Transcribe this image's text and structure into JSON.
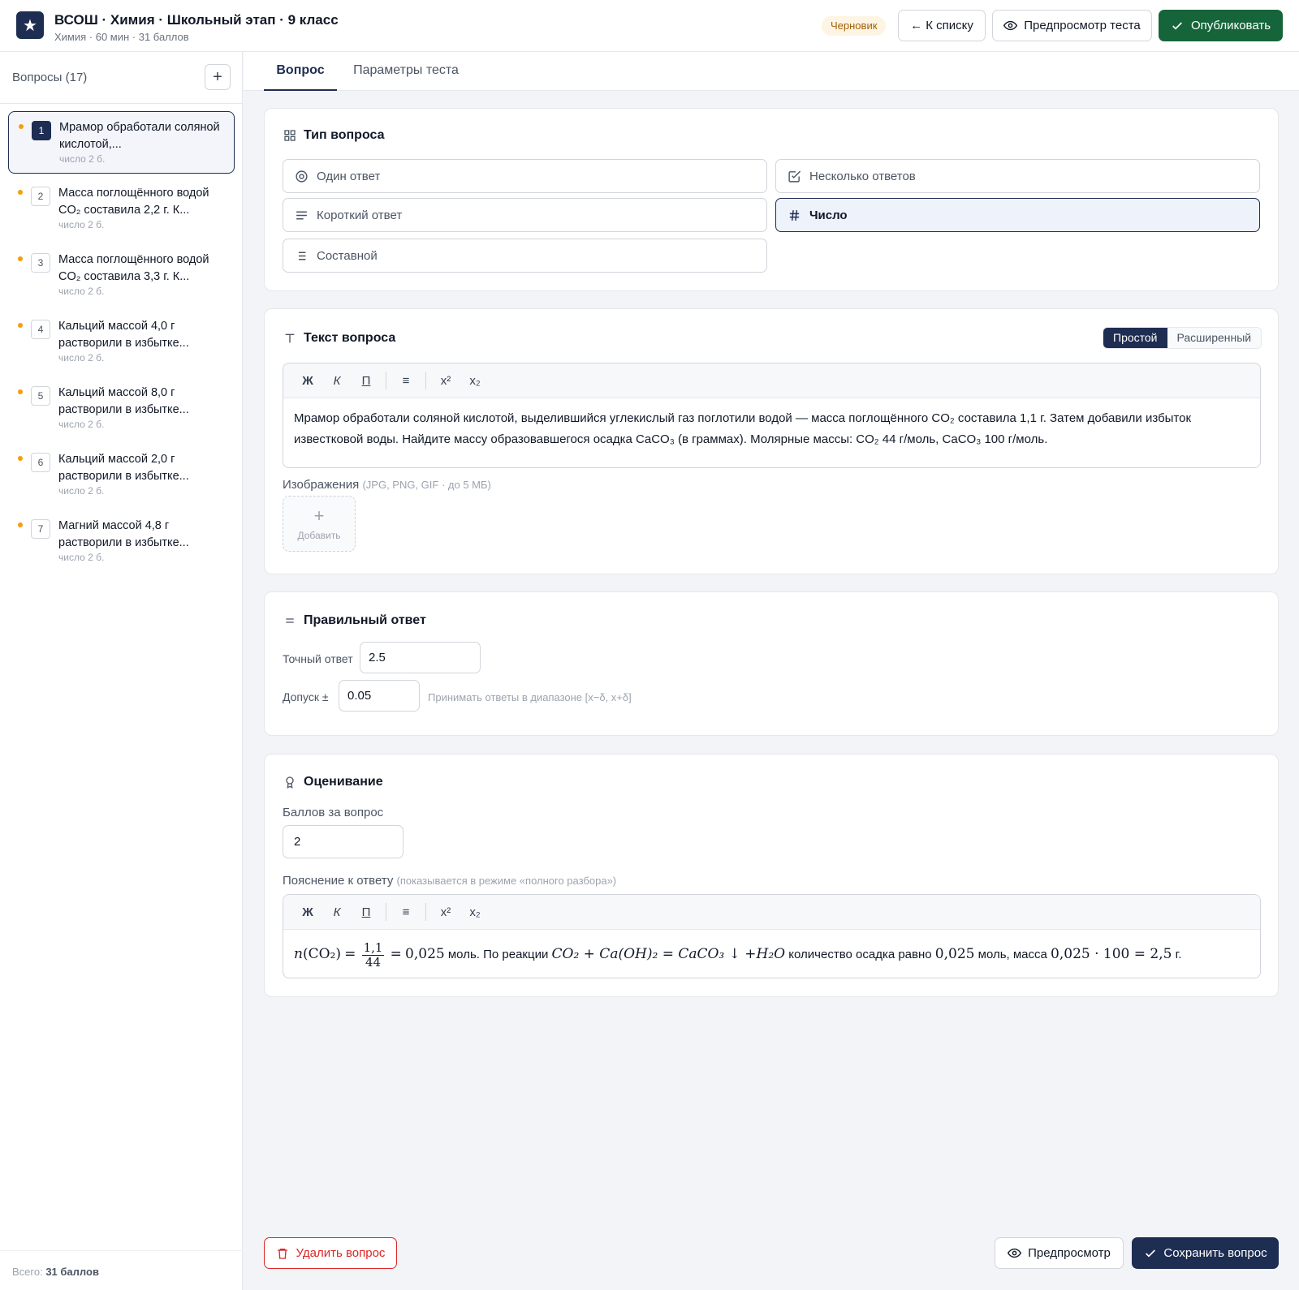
{
  "header": {
    "logo_glyph": "★",
    "title": "ВСОШ · Химия · Школьный этап · 9 класс",
    "subtitle": "Химия · 60 мин · 31 баллов",
    "status_badge": "Черновик",
    "back_button": "← К списку",
    "preview_button": "Предпросмотр теста",
    "publish_button": "Опубликовать"
  },
  "sidebar": {
    "title": "Вопросы (17)",
    "add_glyph": "+",
    "total_label": "Всего:",
    "total_value": "31 баллов",
    "items": [
      {
        "num": "1",
        "text": "Мрамор обработали соляной кислотой,...",
        "meta": "число  2 б."
      },
      {
        "num": "2",
        "text": "Масса поглощённого водой CO₂ составила 2,2 г. К...",
        "meta": "число  2 б."
      },
      {
        "num": "3",
        "text": "Масса поглощённого водой CO₂ составила 3,3 г. К...",
        "meta": "число  2 б."
      },
      {
        "num": "4",
        "text": "Кальций массой 4,0 г растворили в избытке...",
        "meta": "число  2 б."
      },
      {
        "num": "5",
        "text": "Кальций массой 8,0 г растворили в избытке...",
        "meta": "число  2 б."
      },
      {
        "num": "6",
        "text": "Кальций массой 2,0 г растворили в избытке...",
        "meta": "число  2 б."
      },
      {
        "num": "7",
        "text": "Магний массой 4,8 г растворили в избытке...",
        "meta": "число  2 б."
      }
    ]
  },
  "tabs": [
    "Вопрос",
    "Параметры теста"
  ],
  "question_type": {
    "title": "Тип вопроса",
    "options": [
      "Один ответ",
      "Несколько ответов",
      "Короткий ответ",
      "Число",
      "Составной"
    ],
    "selected": "Число"
  },
  "question_text": {
    "title": "Текст вопроса",
    "mode_simple": "Простой",
    "mode_advanced": "Расширенный",
    "toolbar": [
      "Ж",
      "К",
      "П",
      "≡",
      "x²",
      "x₂"
    ],
    "body": "Мрамор обработали соляной кислотой, выделившийся углекислый газ поглотили водой — масса поглощённого CO₂ составила 1,1 г. Затем добавили избыток известковой воды. Найдите массу образовавшегося осадка CaCO₃ (в граммах). Молярные массы: CO₂ 44 г/моль, CaCO₃ 100 г/моль.",
    "images_label": "Изображения",
    "images_hint": "(JPG, PNG, GIF · до 5 МБ)",
    "add_image_label": "Добавить"
  },
  "correct_answer": {
    "title": "Правильный ответ",
    "exact_label": "Точный ответ",
    "exact_value": "2.5",
    "tolerance_label": "Допуск ±",
    "tolerance_value": "0.05",
    "tolerance_hint": "Принимать ответы в диапазоне [x−δ, x+δ]"
  },
  "grading": {
    "title": "Оценивание",
    "points_label": "Баллов за вопрос",
    "points_value": "2",
    "explanation_label": "Пояснение к ответу",
    "explanation_hint": "(показывается в режиме «полного разбора»)",
    "explanation": {
      "n": "n",
      "lhs_arg": "(CO₂)",
      "eq": "=",
      "frac_num": "1,1",
      "frac_den": "44",
      "moles": "0,025",
      "t1": " моль. По реакции ",
      "reaction": "CO₂ + Ca(OH)₂ = CaCO₃ ↓ +H₂O",
      "t2": " количество осадка равно ",
      "moles2": "0,025",
      "t3": " моль, масса ",
      "calc": "0,025 · 100 = 2,5",
      "t4": " г."
    }
  },
  "footer": {
    "delete_button": "Удалить вопрос",
    "preview_button": "Предпросмотр",
    "save_button": "Сохранить вопрос"
  },
  "colors": {
    "brand_navy": "#1e2d52",
    "publish_green": "#16653a",
    "delete_red": "#dc2626",
    "draft_amber": "#f59e0b"
  }
}
